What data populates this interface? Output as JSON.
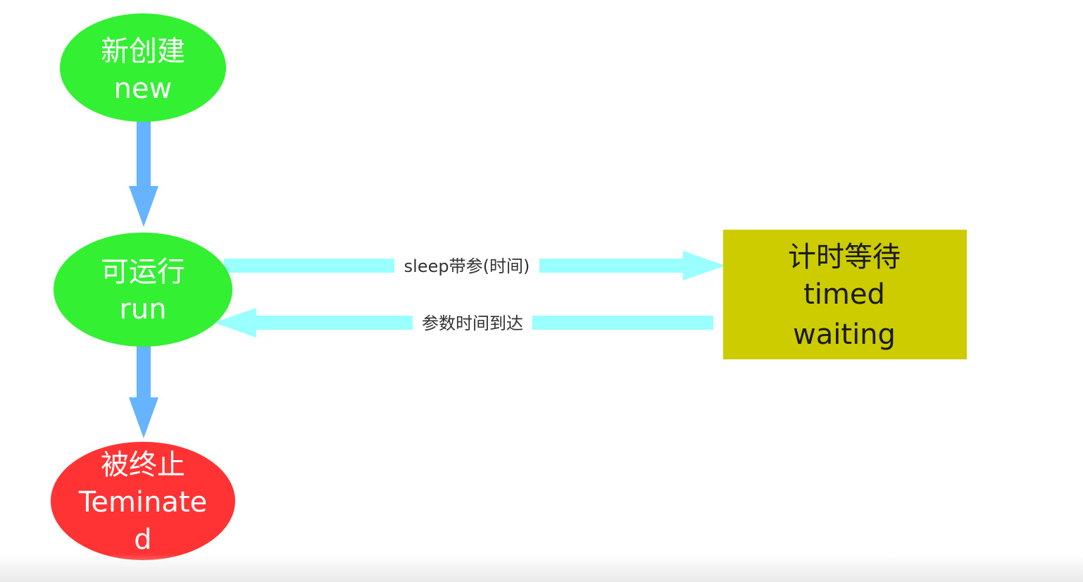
{
  "colors": {
    "state_green": "#33f033",
    "state_red": "#ff3333",
    "state_olive": "#cccc00",
    "arrow_vertical": "#66b3ff",
    "arrow_horizontal": "#99ffff",
    "text_light": "#ffffff",
    "text_dark": "#1a1a1a"
  },
  "nodes": {
    "new": {
      "line1": "新创建",
      "line2": "new"
    },
    "run": {
      "line1": "可运行",
      "line2": "run"
    },
    "terminated": {
      "line1": "被终止",
      "line2": "Teminate",
      "line3": "d"
    },
    "timed_waiting": {
      "line1": "计时等待",
      "line2": "timed",
      "line3": "waiting"
    }
  },
  "edges": {
    "run_to_timed": "sleep带参(时间)",
    "timed_to_run": "参数时间到达"
  }
}
